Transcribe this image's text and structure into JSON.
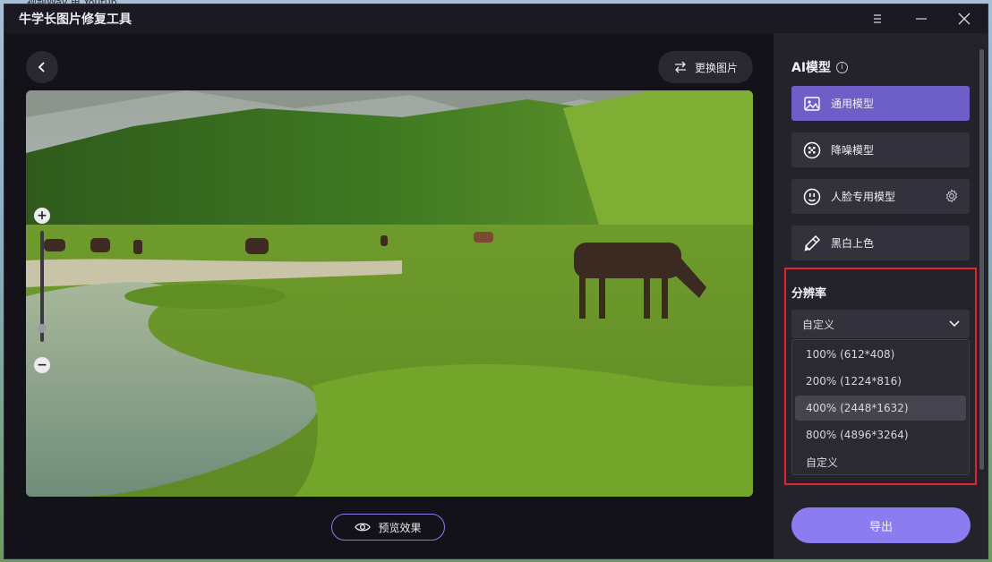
{
  "desktop": {
    "behind_text": "视频Way 电 Youtub..."
  },
  "window": {
    "title": "牛学长图片修复工具",
    "controls": [
      "menu-icon",
      "minimize-icon",
      "close-icon"
    ]
  },
  "main": {
    "replace_label": "更换图片",
    "preview_label": "预览效果",
    "zoom": {
      "plus": "+",
      "minus": "−",
      "level": 0.9
    }
  },
  "side": {
    "ai_title": "AI模型",
    "info_symbol": "i",
    "models": [
      {
        "label": "通用模型",
        "icon": "image-icon",
        "active": true
      },
      {
        "label": "降噪模型",
        "icon": "denoise-icon",
        "active": false
      },
      {
        "label": "人脸专用模型",
        "icon": "face-icon",
        "active": false
      },
      {
        "label": "黑白上色",
        "icon": "colorize-icon",
        "active": false
      }
    ],
    "resolution_title": "分辨率",
    "select_value": "自定义",
    "options": [
      "100% (612*408)",
      "200% (1224*816)",
      "400% (2448*1632)",
      "800% (4896*3264)",
      "自定义"
    ],
    "hovered_option": 2,
    "export_label": "导出"
  },
  "colors": {
    "accent": "#8b7cf0",
    "active_model": "#6e5fc8",
    "highlight": "#e8222a"
  }
}
